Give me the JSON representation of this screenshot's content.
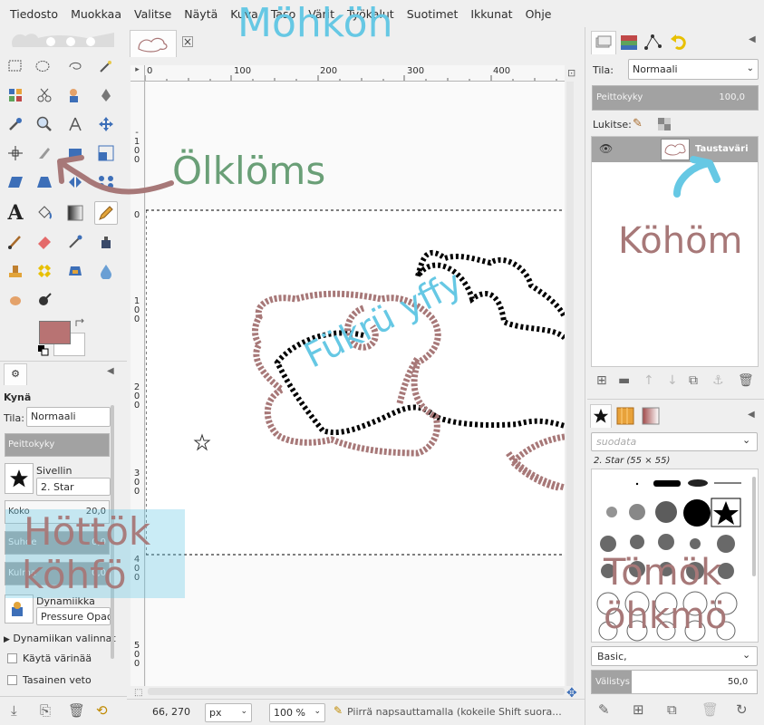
{
  "menubar": {
    "items": [
      "Tiedosto",
      "Muokkaa",
      "Valitse",
      "Näytä",
      "Kuva",
      "Taso",
      "Värit",
      "Työkalut",
      "Suotimet",
      "Ikkunat",
      "Ohje"
    ]
  },
  "colors": {
    "foreground": "#b87373",
    "background": "#ffffff",
    "annotation_mauve": "#a77878",
    "annotation_cyan": "#66c8e4",
    "annotation_green": "#6a9f77"
  },
  "tool_options": {
    "title": "Kynä",
    "mode_label": "Tila:",
    "mode_value": "Normaali",
    "opacity_label": "Peittokyky",
    "brush_label": "Sivellin",
    "brush_value": "2. Star",
    "size_label": "Koko",
    "size_value": "20,0",
    "aspect_label": "Suhde",
    "aspect_value": "0,0",
    "angle_label": "Kulma",
    "angle_value": "0,0",
    "dynamics_label": "Dynamiikka",
    "dynamics_value": "Pressure Opaci",
    "dynamics_options_label": "Dynamiikan valinnat",
    "apply_jitter_label": "Käytä värinää",
    "smooth_stroke_label": "Tasainen veto"
  },
  "rulers": {
    "h_ticks": [
      "0",
      "100",
      "200",
      "300",
      "400"
    ],
    "v_ticks": [
      "0",
      "100",
      "200",
      "300",
      "400",
      "500"
    ],
    "v_neg_tick": "-100"
  },
  "statusbar": {
    "coords": "66, 270",
    "unit": "px",
    "zoom": "100 %",
    "message": "Piirrä napsauttamalla (kokeile Shift suora..."
  },
  "layers": {
    "mode_label": "Tila:",
    "mode_value": "Normaali",
    "opacity_label": "Peittokyky",
    "opacity_value": "100,0",
    "lock_label": "Lukitse:",
    "layer_name": "Taustaväri"
  },
  "brushes": {
    "filter_placeholder": "suodata",
    "selected_brush": "2. Star (55 × 55)",
    "preset_value": "Basic,",
    "spacing_label": "Välistys",
    "spacing_value": "50,0"
  },
  "annotations": {
    "title": "Möhköh",
    "tool_note": "Ölklöms",
    "layer_note": "Köhöm",
    "canvas_note": "Fükrü yffy",
    "options_note_line1": "Höttök",
    "options_note_line2": "köhfö",
    "brush_note_line1": "Tömök",
    "brush_note_line2": "öhkmö"
  }
}
